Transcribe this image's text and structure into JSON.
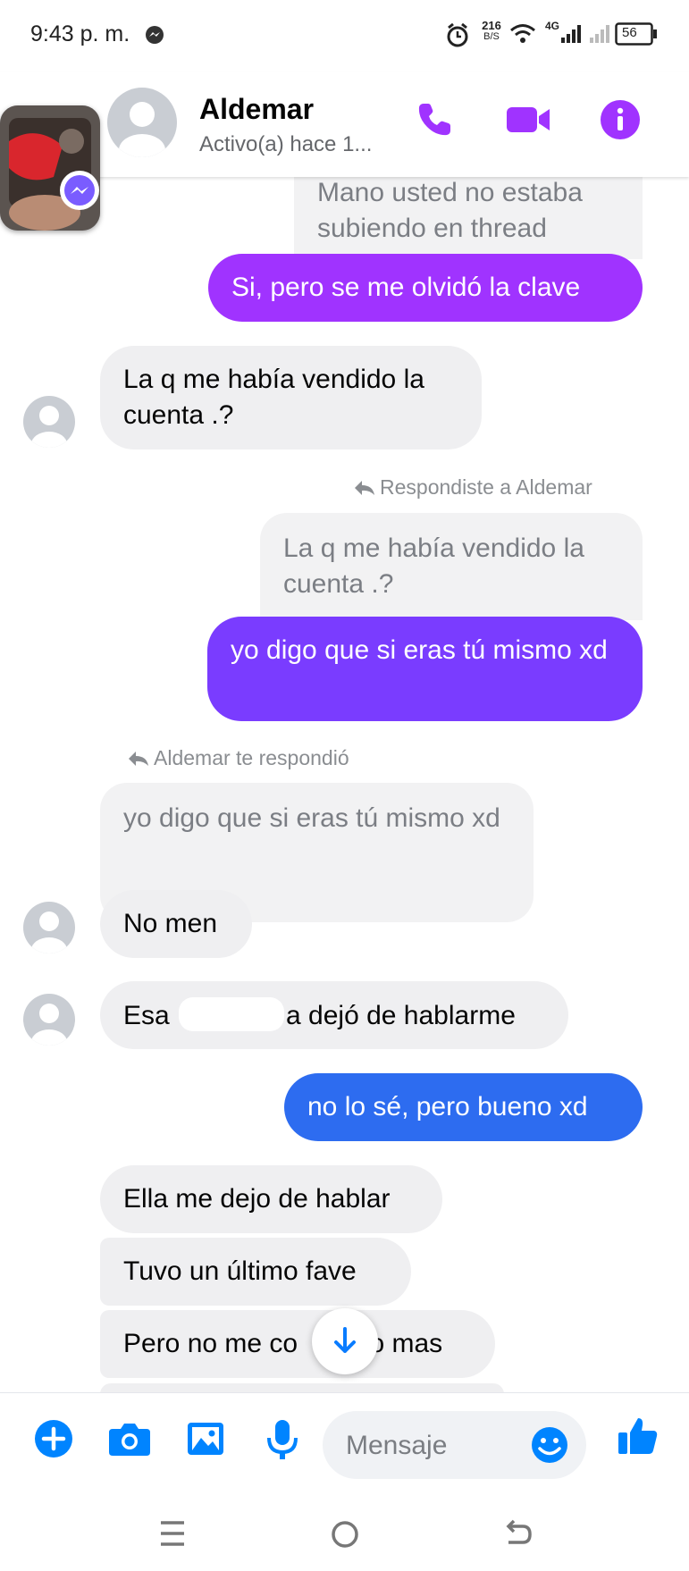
{
  "status_bar": {
    "time": "9:43 p. m.",
    "net_speed_top": "216",
    "net_speed_bottom": "B/S",
    "network_type": "4G",
    "battery": "56"
  },
  "header": {
    "contact_name": "Aldemar",
    "contact_status": "Activo(a) hace 1...",
    "accent_color": "#a033ff"
  },
  "messages": {
    "m1_quoted": "Mano usted no estaba subiendo en thread",
    "m2_out": "Si, pero se me olvidó la clave",
    "m3_in": "La q me había vendido la cuenta .?",
    "m4_reply_label": "Respondiste a Aldemar",
    "m4_quoted": "La q me había vendido la cuenta .?",
    "m4_out": "yo digo que si eras tú mismo xd",
    "m5_reply_label": "Aldemar te respondió",
    "m5_quoted": "yo digo que si eras tú mismo xd",
    "m5_in": "No men",
    "m6_in_start": "Esa ",
    "m6_in_end": "a dejó de hablarme",
    "m7_out": "no lo sé, pero bueno xd",
    "m8_in": "Ella me dejo de hablar",
    "m9_in": "Tuvo un último fave",
    "m10_in_start": "Pero no me co",
    "m10_in_end": "to mas"
  },
  "composer": {
    "placeholder": "Mensaje"
  },
  "colors": {
    "bubble_in": "#efeff1",
    "gradient_purple": "#a033ff",
    "gradient_violet": "#7a3cff",
    "gradient_blue": "#2d6cf0",
    "icon_blue": "#0084ff"
  },
  "icons": [
    "messenger-icon",
    "alarm-icon",
    "wifi-icon",
    "signal-icon",
    "battery-icon",
    "phone-icon",
    "video-icon",
    "info-icon",
    "reply-arrow-icon",
    "scroll-down-icon",
    "plus-icon",
    "camera-icon",
    "gallery-icon",
    "microphone-icon",
    "emoji-icon",
    "like-icon",
    "menu-icon",
    "home-icon",
    "back-icon"
  ]
}
